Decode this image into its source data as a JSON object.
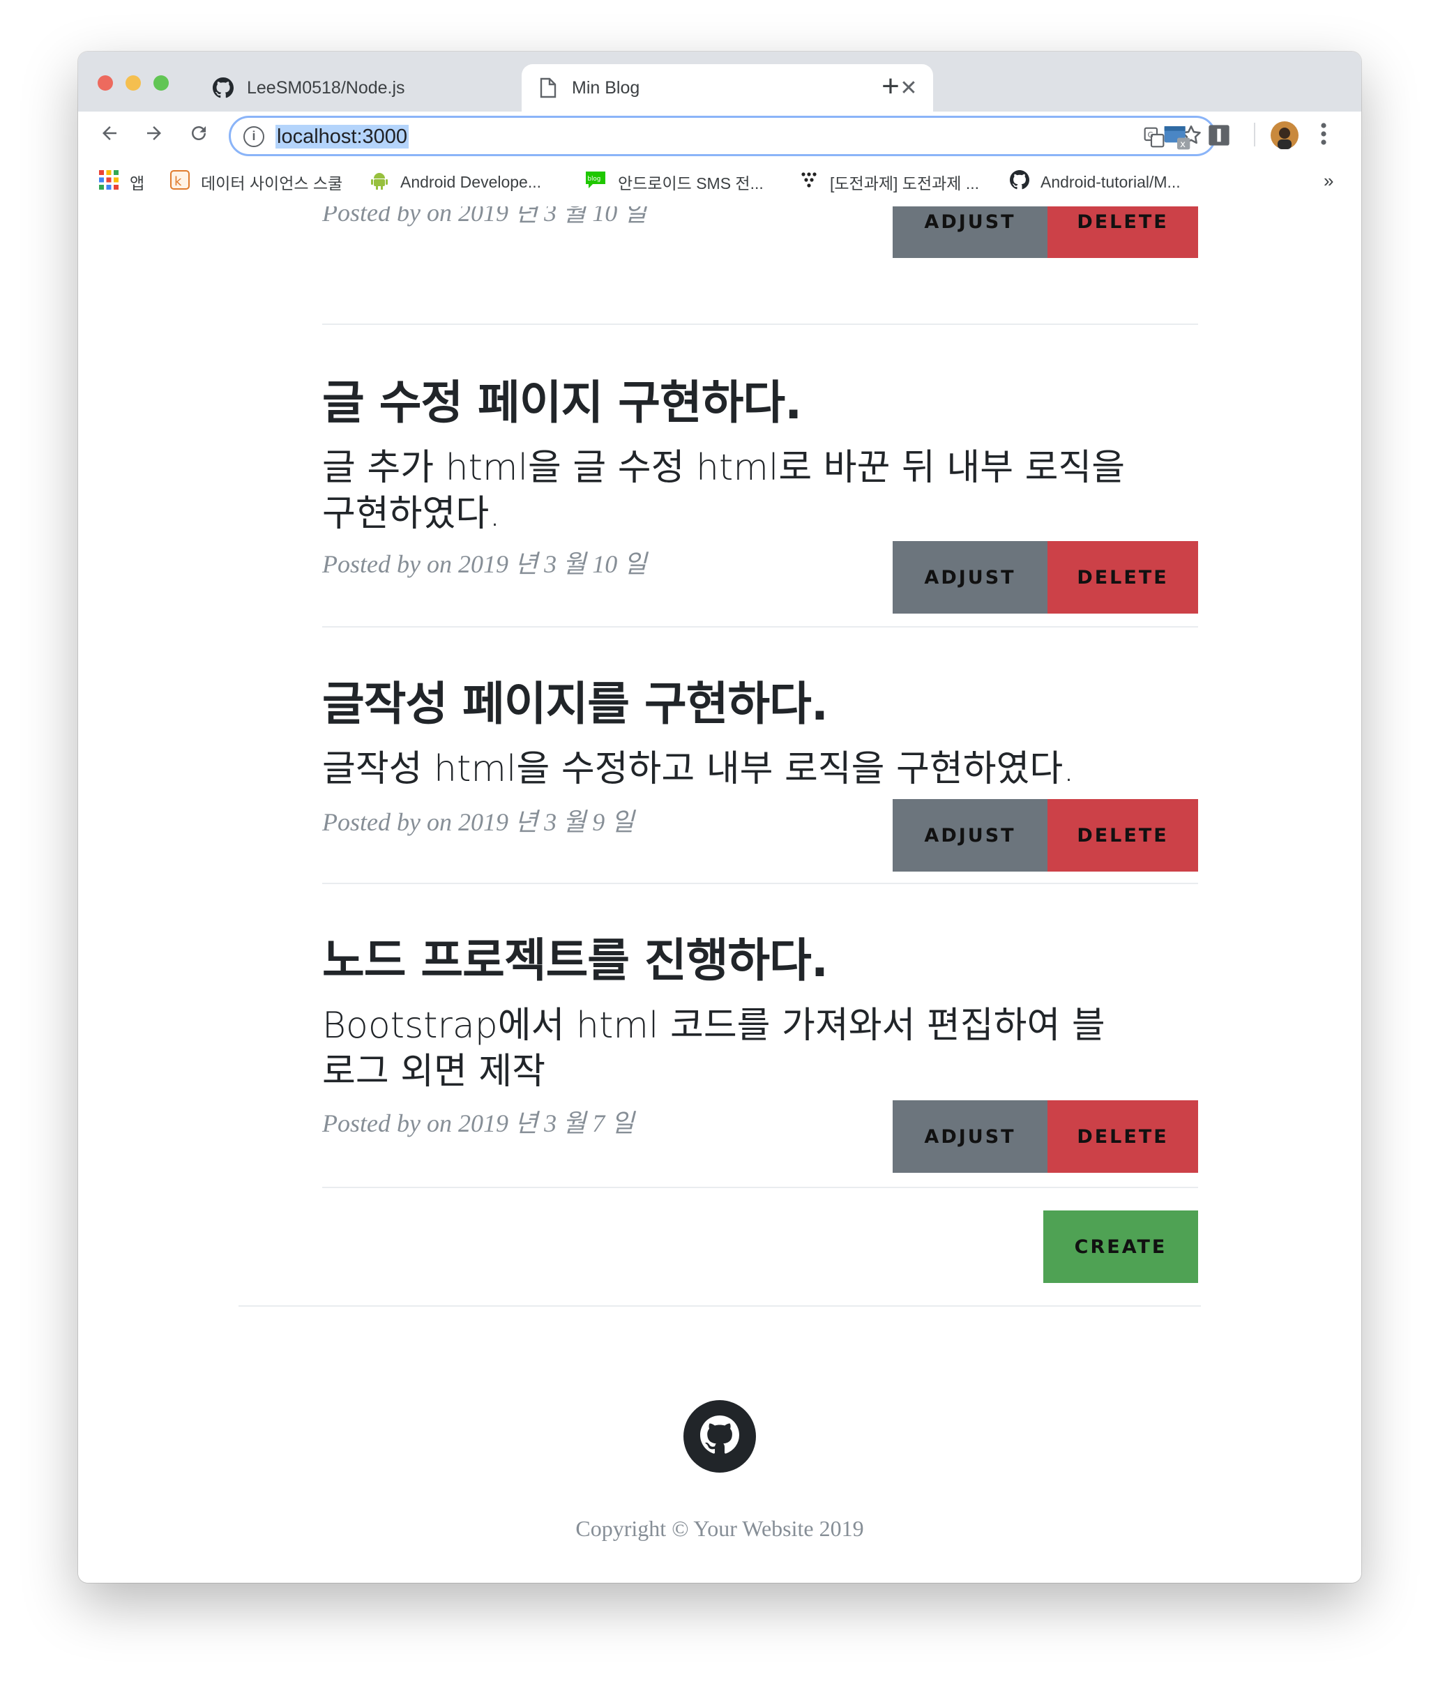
{
  "browser": {
    "tabs": [
      {
        "label": "LeeSM0518/Node.js",
        "icon": "github-icon",
        "close": "✕"
      },
      {
        "label": "Min Blog",
        "icon": "page-icon",
        "close": "✕"
      }
    ],
    "new_tab": "+",
    "url": "localhost:3000",
    "bookmarks": [
      {
        "label": "앱",
        "icon": "apps-grid-icon"
      },
      {
        "label": "데이터 사이언스 스쿨",
        "icon": "datascience-icon"
      },
      {
        "label": "Android Develope...",
        "icon": "android-icon"
      },
      {
        "label": "안드로이드 SMS 전...",
        "icon": "blog-icon"
      },
      {
        "label": "[도전과제] 도전과제 ...",
        "icon": "dots-icon"
      },
      {
        "label": "Android-tutorial/M...",
        "icon": "github-icon"
      }
    ],
    "more_bookmarks": "»",
    "colors": {
      "tabstrip": "#dee1e6",
      "omnibox_border": "#8ab4f8",
      "selection": "#b4d4fb"
    }
  },
  "posts": [
    {
      "title": "",
      "subtitle": "",
      "meta": "Posted by on 2019 년 3 월 10 일",
      "adjust": "ADJUST",
      "delete": "DELETE"
    },
    {
      "title": "글 수정 페이지 구현하다.",
      "subtitle": "글 추가 html을 글 수정 html로 바꾼 뒤 내부 로직을 구현하였다.",
      "meta": "Posted by on 2019 년 3 월 10 일",
      "adjust": "ADJUST",
      "delete": "DELETE"
    },
    {
      "title": "글작성 페이지를 구현하다.",
      "subtitle": "글작성 html을 수정하고 내부 로직을 구현하였다.",
      "meta": "Posted by on 2019 년 3 월 9 일",
      "adjust": "ADJUST",
      "delete": "DELETE"
    },
    {
      "title": "노드 프로젝트를 진행하다.",
      "subtitle": "Bootstrap에서 html 코드를 가져와서 편집하여 블로그 외면 제작",
      "meta": "Posted by on 2019 년 3 월 7 일",
      "adjust": "ADJUST",
      "delete": "DELETE"
    }
  ],
  "create_label": "CREATE",
  "footer": {
    "icon": "github-icon",
    "copyright": "Copyright © Your Website 2019"
  },
  "colors": {
    "adjust": "#6c757d",
    "delete": "#cc4148",
    "create": "#4fa254",
    "meta": "#868e96"
  }
}
